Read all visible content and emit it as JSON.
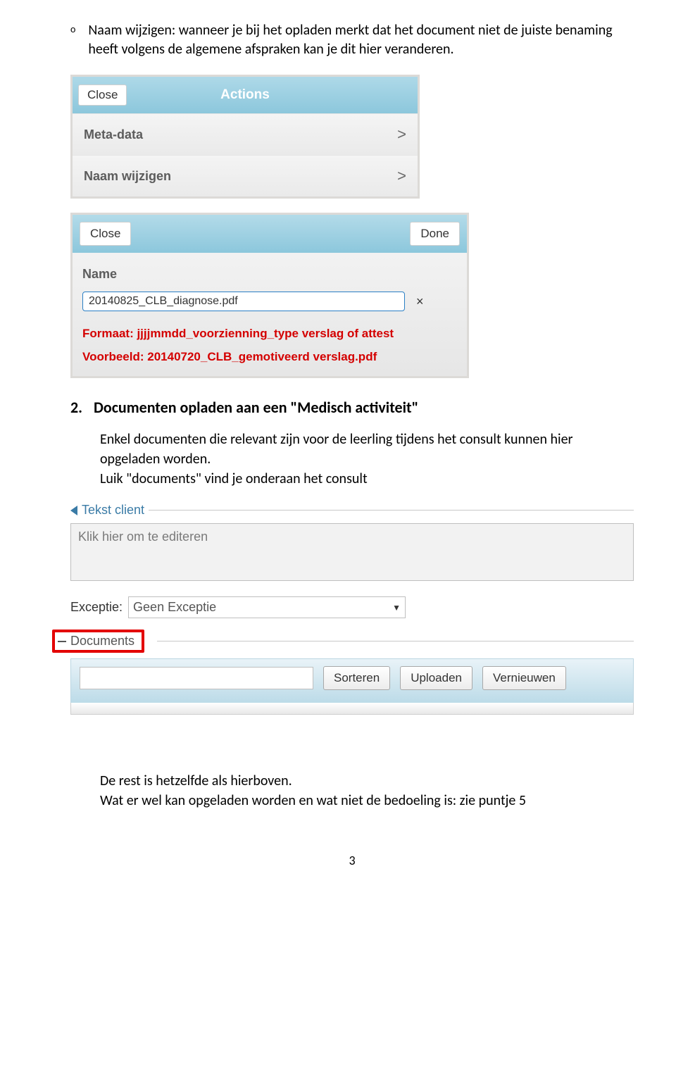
{
  "intro": {
    "bullet": "o",
    "text": "Naam wijzigen:  wanneer je bij het opladen merkt dat het document niet de juiste benaming heeft volgens de algemene afspraken kan je dit hier veranderen."
  },
  "panel1": {
    "close": "Close",
    "title": "Actions",
    "rows": [
      {
        "label": "Meta-data",
        "chevron": ">"
      },
      {
        "label": "Naam wijzigen",
        "chevron": ">"
      }
    ]
  },
  "panel2": {
    "close": "Close",
    "done": "Done",
    "name_label": "Name",
    "input_value": "20140825_CLB_diagnose.pdf",
    "clear": "×",
    "format_line": "Formaat: jjjjmmdd_voorzienning_type verslag of attest",
    "example_line": "Voorbeeld: 20140720_CLB_gemotiveerd verslag.pdf"
  },
  "section2": {
    "num": "2.",
    "title": "Documenten opladen aan een \"Medisch activiteit\"",
    "body1": "Enkel documenten die relevant  zijn voor de leerling tijdens het consult kunnen hier opgeladen worden.",
    "body2": "Luik \"documents\" vind je onderaan het consult"
  },
  "panel3": {
    "tekst_client_label": "Tekst client",
    "placeholder": "Klik hier om te editeren",
    "exceptie_label": "Exceptie:",
    "exceptie_value": "Geen Exceptie",
    "documents_label": "Documents",
    "buttons": {
      "sorteren": "Sorteren",
      "uploaden": "Uploaden",
      "vernieuwen": "Vernieuwen"
    }
  },
  "footer": {
    "line1": "De rest is hetzelfde als hierboven.",
    "line2": "Wat er wel kan opgeladen worden en wat niet de bedoeling is: zie puntje 5"
  },
  "page_number": "3"
}
